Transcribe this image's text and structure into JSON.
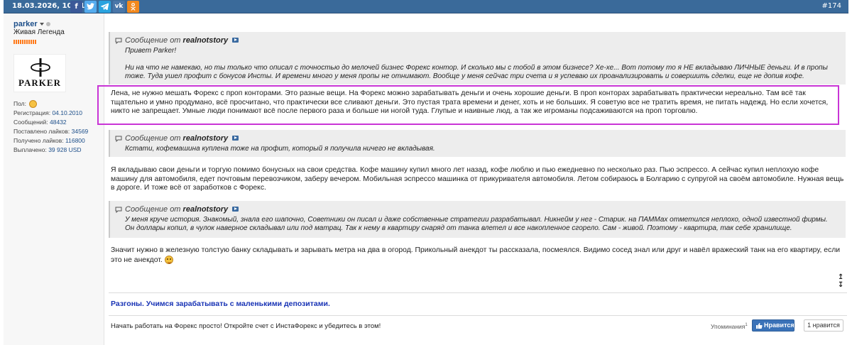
{
  "topbar": {
    "datetime": "18.03.2026, 10:51",
    "post_number": "#174",
    "share_icons": [
      "facebook-icon",
      "twitter-icon",
      "telegram-icon",
      "vk-icon",
      "odnoklassniki-icon"
    ],
    "share_colors": [
      "#3b5998",
      "#55acee",
      "#2aa3df",
      "#4a76a8",
      "#f2891e"
    ]
  },
  "user": {
    "name": "parker",
    "title": "Живая Легенда",
    "avatar_text": "PARKER",
    "stats": {
      "gender_label": "Пол:",
      "reg_label": "Регистрация:",
      "reg_value": "04.10.2010",
      "msgs_label": "Сообщений:",
      "msgs_value": "48432",
      "likes_given_label": "Поставлено лайков:",
      "likes_given_value": "34569",
      "likes_recv_label": "Получено лайков:",
      "likes_recv_value": "116800",
      "paid_label": "Выплачено:",
      "paid_value": "39 928 USD"
    }
  },
  "post": {
    "quote1": {
      "header_prefix": "Сообщение от",
      "author": "realnotstory",
      "greeting": "Привет Parker!",
      "text": "Ни на что не намекаю, но ты только что описал с точностью до мелочей бизнес Форекс контор. И сколько мы с тобой в этом бизнесе? Хе-хе... Вот потому то я НЕ вкладываю ЛИЧНЫЕ деньги. И в пропы тоже. Туда ушел профит с бонусов Инсты. И времени много у меня пропы не отнимают. Вообще у меня сейчас три счета и я успеваю их проанализировать и совершить сделки, еще не допив кофе."
    },
    "highlighted_reply": "Лена, не нужно мешать Форекс с проп конторами. Это разные вещи. На Форекс можно зарабатывать деньги и очень хорошие деньги. В проп конторах зарабатывать практически нереально. Там всё так тщательно и умно продумано, всё просчитано, что практически все сливают деньги. Это пустая трата времени и денег, хоть и не больших. Я советую все не тратить время, не питать надежд. Но если хочется, никто не запрещает. Умные люди понимают всё после первого раза и больше ни ногой туда. Глупые и наивные люд, а так же игроманы подсаживаются на проп торговлю.",
    "quote2": {
      "header_prefix": "Сообщение от",
      "author": "realnotstory",
      "text": "Кстати, кофемашина куплена тоже на профит, который я получила ничего не вкладывая."
    },
    "reply2": "Я вкладываю свои деньги и торгую помимо бонусных на свои средства. Кофе машину купил много лет назад, кофе люблю и пью ежедневно по несколько раз. Пью эспрессо. А сейчас купил неплохую кофе машину для автомобиля, едет почтовым перевозчиком, заберу вечером. Мобильная эспрессо машинка от прикуривателя автомобиля. Летом собираюсь в Болгарию с супругой на своём автомобиле. Нужная вещь в дороге. И тоже всё от заработков с Форекс.",
    "quote3": {
      "header_prefix": "Сообщение от",
      "author": "realnotstory",
      "line1": "У меня круче история. Знакомый, знала его шапочно, Советники он писал и даже собственные стратегии разрабатывал. Никнейм у нег - Старик. на ПАММах отметился неплохо, одной известной фирмы.",
      "line2": "Он доллары копил, в чулок наверное складывал или под матрац. Так к нему в квартиру снаряд от танка влетел и все накопленное сгорело. Сам - живой. Поэтому - квартира, так себе хранилище."
    },
    "reply3": "Значит нужно в железную толстую банку складывать и зарывать метра на два в огород. Прикольный анекдот ты рассказала, посмеялся. Видимо сосед знал или друг и навёл вражеский танк на его квартиру, если это не анекдот.",
    "signature_link": "Разгоны. Учимся зарабатывать с маленькими депозитами.",
    "footer_text": "Начать работать на Форекс просто! Откройте счет с ИнстаФорекс и убедитесь в этом!",
    "mentions_label": "Упоминания",
    "mentions_count": "1",
    "like_button": "Нравится",
    "like_count": "1 нравится"
  }
}
